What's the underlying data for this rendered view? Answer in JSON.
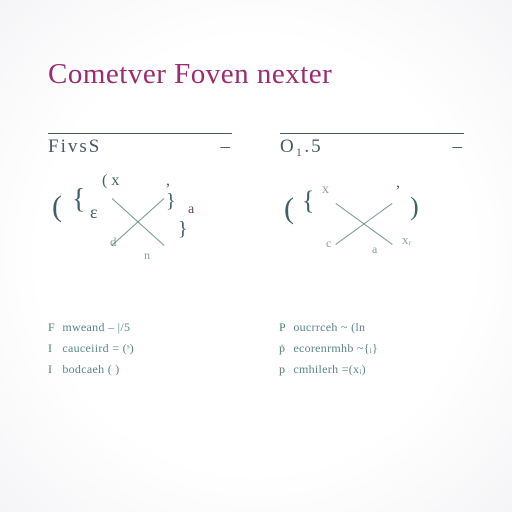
{
  "title": "Cometver Foven nexter",
  "columns": {
    "left": {
      "heading": "FivsS",
      "elements": {
        "e1": "(",
        "e2": "{",
        "e3": "ɛ",
        "e4": "( x",
        "e5": "d",
        "e6": ",",
        "e7": "}",
        "e8": "a",
        "e9": "}",
        "e10": "n"
      }
    },
    "right": {
      "heading": "O₁.5",
      "elements": {
        "e1": "(",
        "e2": "{",
        "e3": "x",
        "e4": ",",
        "e5": ")",
        "e6": "c",
        "e7": "a",
        "e8": "xᵣ"
      }
    }
  },
  "notes": {
    "n1": {
      "sym": "F",
      "text": "mweand  – |/5"
    },
    "n2": {
      "sym": "P",
      "text": "oucrrceh  ~ (ln"
    },
    "n3": {
      "sym": "I",
      "text": "cauceiird = (ˢ)"
    },
    "n4": {
      "sym": "ṗ",
      "text": "ecorenrmhb ~{ᵢ}"
    },
    "n5": {
      "sym": "I",
      "text": "bodcaeh  ( )"
    },
    "n6": {
      "sym": "p",
      "text": "cmhilerh =(xᵢ)"
    }
  }
}
